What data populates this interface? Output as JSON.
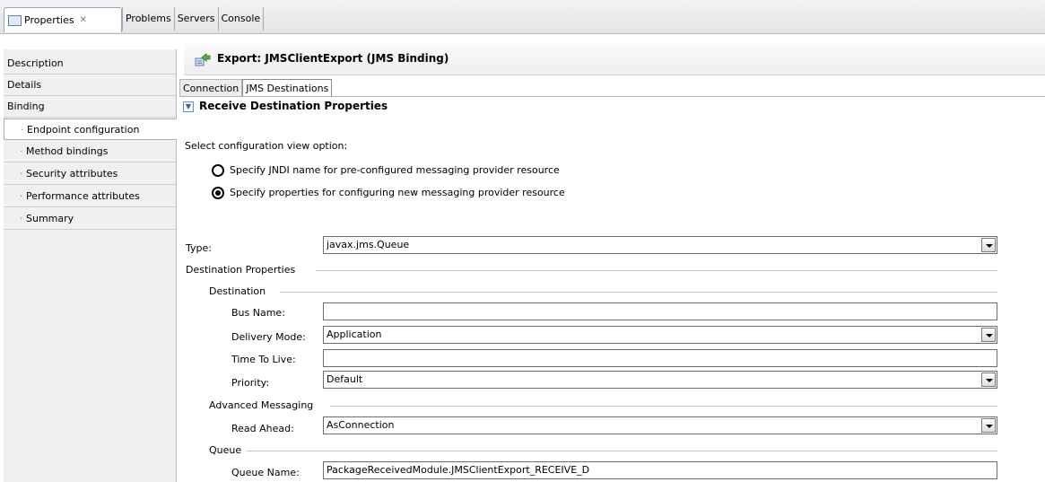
{
  "view_tabs": [
    {
      "label": "Properties",
      "active": true
    },
    {
      "label": "Problems"
    },
    {
      "label": "Servers"
    },
    {
      "label": "Console"
    }
  ],
  "sidebar": {
    "items": [
      {
        "label": "Description"
      },
      {
        "label": "Details"
      },
      {
        "label": "Binding"
      },
      {
        "label": "Endpoint configuration",
        "selected": true
      },
      {
        "label": "Method bindings"
      },
      {
        "label": "Security attributes"
      },
      {
        "label": "Performance attributes"
      },
      {
        "label": "Summary"
      }
    ]
  },
  "header": {
    "title": "Export: JMSClientExport (JMS Binding)"
  },
  "editor_tabs": [
    {
      "label": "Connection"
    },
    {
      "label": "JMS Destinations",
      "active": true
    }
  ],
  "section": {
    "title": "Receive Destination Properties"
  },
  "config_view": {
    "label": "Select configuration view option:",
    "options": [
      {
        "label": "Specify JNDI name for pre-configured messaging provider resource",
        "selected": false
      },
      {
        "label": "Specify properties for configuring new messaging provider resource",
        "selected": true
      }
    ]
  },
  "form": {
    "type_label": "Type:",
    "type_value": "javax.jms.Queue",
    "destination_properties": "Destination Properties",
    "destination": "Destination",
    "bus_name_label": "Bus Name:",
    "bus_name_value": "",
    "delivery_mode_label": "Delivery Mode:",
    "delivery_mode_value": "Application",
    "time_to_live_label": "Time To Live:",
    "time_to_live_value": "",
    "priority_label": "Priority:",
    "priority_value": "Default",
    "advanced_messaging": "Advanced Messaging",
    "read_ahead_label": "Read Ahead:",
    "read_ahead_value": "AsConnection",
    "queue": "Queue",
    "queue_name_label": "Queue Name:",
    "queue_name_value": "PackageReceivedModule.JMSClientExport_RECEIVE_D"
  }
}
